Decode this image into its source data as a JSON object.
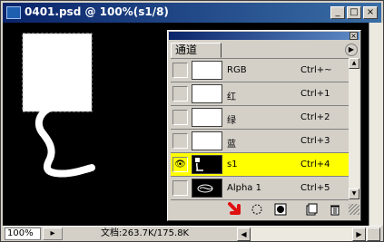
{
  "window": {
    "title": "0401.psd @ 100%(s1/8)",
    "minimize_label": "_",
    "maximize_label": "□",
    "close_label": "×"
  },
  "status_bar": {
    "zoom": "100%",
    "doc_size": "文档:263.7K/175.8K",
    "arrow_label": "▸",
    "scroll_left": "◀",
    "scroll_right": "▶"
  },
  "channels_palette": {
    "tab_label": "通道",
    "close_label": "×",
    "menu_label": "▶",
    "channels": [
      {
        "name": "RGB",
        "shortcut": "Ctrl+~",
        "visible": false,
        "selected": false
      },
      {
        "name": "红",
        "shortcut": "Ctrl+1",
        "visible": false,
        "selected": false
      },
      {
        "name": "绿",
        "shortcut": "Ctrl+2",
        "visible": false,
        "selected": false
      },
      {
        "name": "蓝",
        "shortcut": "Ctrl+3",
        "visible": false,
        "selected": false
      },
      {
        "name": "s1",
        "shortcut": "Ctrl+4",
        "visible": true,
        "selected": true
      },
      {
        "name": "Alpha 1",
        "shortcut": "Ctrl+5",
        "visible": false,
        "selected": false
      }
    ],
    "eye_glyph": "👁",
    "scroll_up": "▲",
    "scroll_down": "▼"
  },
  "colors": {
    "selected_row": "#ffff00",
    "title_bar": "#0a246a",
    "canvas": "#000000",
    "indicator_arrow": "#e01010"
  }
}
